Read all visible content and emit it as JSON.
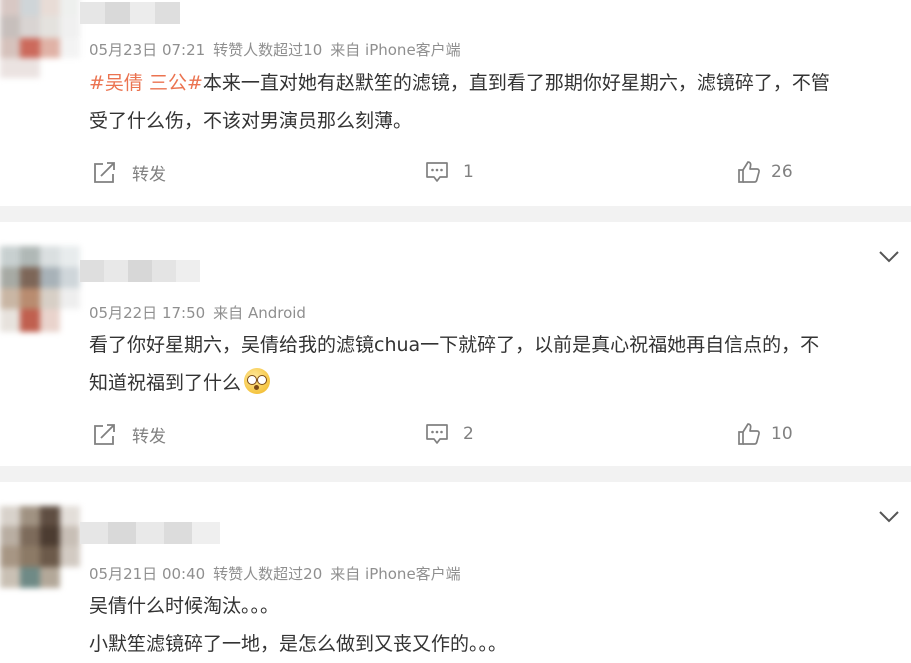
{
  "posts": [
    {
      "meta": {
        "date": "05月23日 07:21",
        "reposts": "转赞人数超过10",
        "source": "来自 iPhone客户端"
      },
      "hashtag": "#吴倩 三公#",
      "lines": [
        "本来一直对她有赵默笙的滤镜，直到看了那期你好星期六，滤镜碎了，不管",
        "受了什么伤，不该对男演员那么刻薄。"
      ],
      "actions": {
        "repost": "转发",
        "comments": "1",
        "likes": "26"
      }
    },
    {
      "meta": {
        "date": "05月22日 17:50",
        "source": "来自 Android"
      },
      "lines": [
        "看了你好星期六，吴倩给我的滤镜chua一下就碎了，以前是真心祝福她再自信点的，不",
        "知道祝福到了什么"
      ],
      "emoji_icon": "flushed-face-emoji",
      "actions": {
        "repost": "转发",
        "comments": "2",
        "likes": "10"
      }
    },
    {
      "meta": {
        "date": "05月21日 00:40",
        "reposts": "转赞人数超过20",
        "source": "来自 iPhone客户端"
      },
      "lines": [
        "吴倩什么时候淘汰。。。",
        "小默笙滤镜碎了一地，是怎么做到又丧又作的。。。"
      ]
    }
  ],
  "icons": {
    "repost": "share-square-icon",
    "comment": "comment-bubble-icon",
    "like": "thumbs-up-icon",
    "expand": "chevron-down-icon"
  },
  "colors": {
    "hashtag": "#eb7350",
    "meta": "#8f8f8f",
    "separator": "#f2f2f2",
    "icon": "#808080"
  }
}
